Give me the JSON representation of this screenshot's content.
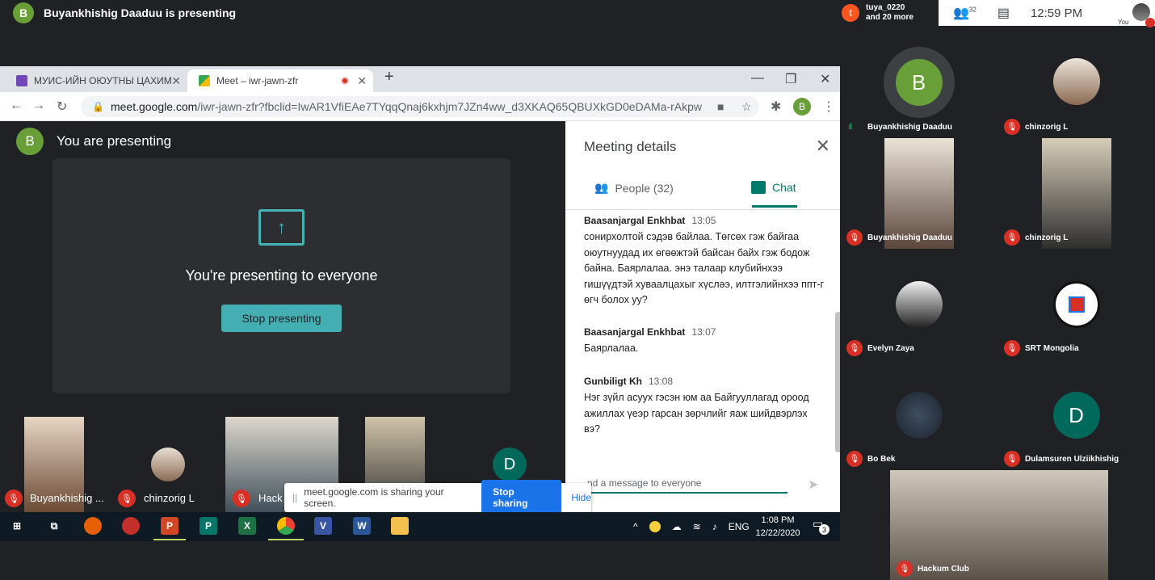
{
  "top_bar": {
    "avatar_letter": "B",
    "presenting_text": "Buyankhishig Daaduu is presenting"
  },
  "status_bar": {
    "notif_avatar": "t",
    "notif_name": "tuya_0220",
    "notif_more": "and 20 more",
    "people_count": "32",
    "time": "12:59",
    "time_suffix": "PM",
    "you_label": "You"
  },
  "right_tiles": [
    {
      "name": "Buyankhishig Daaduu",
      "letter": "B",
      "speaking": true
    },
    {
      "name": "chinzorig L"
    },
    {
      "name": "Buyankhishig Daaduu"
    },
    {
      "name": "chinzorig L"
    },
    {
      "name": "Evelyn Zaya"
    },
    {
      "name": "SRT Mongolia"
    },
    {
      "name": "Bo Bek"
    },
    {
      "name": "Dulamsuren Ulziikhishig",
      "letter": "D"
    },
    {
      "name": "Hackum Club"
    }
  ],
  "browser": {
    "tab1_label": "МУИС-ИЙН ОЮУТНЫ ЦАХИМ",
    "tab2_label": "Meet – iwr-jawn-zfr",
    "url_host": "meet.google.com",
    "url_path": "/iwr-jawn-zfr?fbclid=IwAR1VfiEAe7TYqqQnaj6kxhjm7JZn4ww_d3XKAQ65QBUXkGD0eDAMa-rAkpw",
    "profile_letter": "B"
  },
  "meet": {
    "avatar_letter": "B",
    "you_presenting": "You are presenting",
    "presenting_everyone": "You're presenting to everyone",
    "stop_presenting": "Stop presenting"
  },
  "filmstrip": [
    {
      "name": "Buyankhishig ..."
    },
    {
      "name": "chinzorig L"
    },
    {
      "name": "Hack"
    },
    {
      "name": ""
    },
    {
      "name": "",
      "letter": "D"
    }
  ],
  "details": {
    "title": "Meeting details",
    "people_tab": "People (32)",
    "chat_tab": "Chat",
    "messages": [
      {
        "author": "Baasanjargal Enkhbat",
        "time": "13:05",
        "text": "сонирхолтой сэдэв байлаа. Төгсөх гэж байгаа оюутнуудад их өгөөжтэй байсан байх гэж бодож байна. Баярлалаа. энэ талаар клубийнхээ гишүүдтэй хуваалцахыг хүсләэ, илтгэлийнхээ ппт-г өгч болох уу?"
      },
      {
        "author": "Baasanjargal Enkhbat",
        "time": "13:07",
        "text": "Баярлалаа."
      },
      {
        "author": "Gunbiligt Kh",
        "time": "13:08",
        "text": "Нэг зүйл асуух гэсэн юм аа Байгууллагад ороод ажиллах үеэр гарсан зөрчлийг яаж шийдвэрлэх вэ?"
      }
    ],
    "input_placeholder": "nd a message to everyone"
  },
  "share_bar": {
    "message": "meet.google.com is sharing your screen.",
    "stop_sharing": "Stop sharing",
    "hide": "Hide"
  },
  "taskbar": {
    "lang": "ENG",
    "time": "1:08 PM",
    "date": "12/22/2020",
    "notif_count": "3"
  }
}
